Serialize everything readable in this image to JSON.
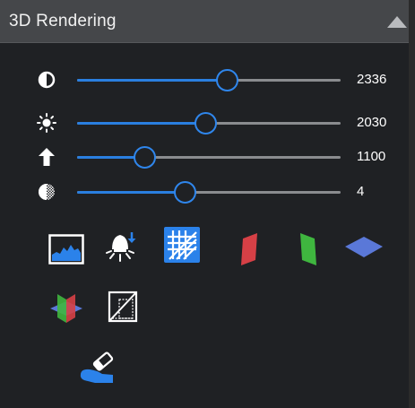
{
  "panel": {
    "title": "3D Rendering",
    "collapse_icon": "caret-up-icon"
  },
  "sliders": [
    {
      "name": "contrast",
      "icon": "contrast-icon",
      "value_label": "2336",
      "level": 0.57
    },
    {
      "name": "brightness",
      "icon": "sun-icon",
      "value_label": "2030",
      "level": 0.49
    },
    {
      "name": "threshold",
      "icon": "arrow-up-icon",
      "value_label": "1100",
      "level": 0.26
    },
    {
      "name": "opacity",
      "icon": "dithered-circle-icon",
      "value_label": "4",
      "level": 0.41
    }
  ],
  "tools": [
    {
      "icon": "landscape-image-icon",
      "active": false
    },
    {
      "icon": "light-source-icon",
      "active": false
    },
    {
      "icon": "grid-hatch-icon",
      "active": true
    },
    {
      "icon": "red-plane-icon",
      "active": false
    },
    {
      "icon": "green-plane-icon",
      "active": false
    },
    {
      "icon": "blue-plane-icon",
      "active": false
    },
    {
      "icon": "three-planes-icon",
      "active": false
    },
    {
      "icon": "bounding-box-icon",
      "active": false
    },
    {
      "icon": "eraser-icon",
      "active": false
    }
  ],
  "colors": {
    "accent": "#2b82ea",
    "plane_red": "#d64046",
    "plane_green": "#3fb63f",
    "plane_blue": "#5a78d8"
  }
}
